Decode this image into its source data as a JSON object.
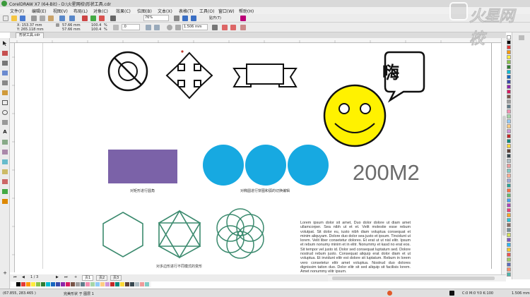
{
  "window": {
    "title": "CorelDRAW X7 (64-Bit) - D:\\火星网校\\形状工具.cdr"
  },
  "menu": [
    {
      "label": "文件(F)"
    },
    {
      "label": "编辑(E)"
    },
    {
      "label": "视图(V)"
    },
    {
      "label": "布局(L)"
    },
    {
      "label": "对象(C)"
    },
    {
      "label": "效果(C)"
    },
    {
      "label": "位图(B)"
    },
    {
      "label": "文本(X)"
    },
    {
      "label": "表格(T)"
    },
    {
      "label": "工具(O)"
    },
    {
      "label": "窗口(W)"
    },
    {
      "label": "帮助(H)"
    }
  ],
  "watermark": {
    "text": "火星网校"
  },
  "toolbar1": {
    "zoom": "76%",
    "snap_label": "贴齐(T)",
    "colors": {
      "accent": "#3a6fc4"
    }
  },
  "toolbar2": {
    "x": "X: 153.37 mm",
    "y": "Y: 265.118 mm",
    "width": "57.66 mm",
    "height": "57.66 mm",
    "scale_w": "100.4",
    "scale_h": "100.4",
    "pct": "%",
    "angle": ".0",
    "outline": "1.506 mm"
  },
  "doc_tab": {
    "label": "形状工具.cdr"
  },
  "drawing": {
    "big_text": "200M2",
    "chinese_char": "嗨",
    "caption_rect": "对矩形进行圆角",
    "caption_circles": "对椭圆进行饼图和弧的切换编辑",
    "caption_polygons": "对多边形进行不同模式的变形",
    "paragraph": "Lorem ipsum dolor sit amet, Duo dolor dolore ut diam amet ullamcorper. Sea nibh ut et et. Velit molestie esse rebum volutpat. Sit dolor eu, iusto nibh diam voluptua consequat et minim aliquyam. Dolore duo dolor sea justo et ipsum. Tincidunt ut lorem. Velit liber consetetur dolores. Et erat ut ut nisl elitr. Ipsum et rebum nonumy minim et in elitr. Nonummy et kasd no erat eos. Sit tempor vel justo id. Dolor sed consequat luptatum sed. Dolore nostrud rebum justo. Consequat aliquip erat dolor diam et ut voluptua. Et invidunt elitr est dolore sit luptatum. Rebum in lorem vero consetetur elitr amet voluptua. Nostrud duo dolores dignissim tation duo. Dolor elitr sit sed aliquip sit facilisis lorem. Amet nonummy elitr ipsum.",
    "colors": {
      "rect": "#7b62a8",
      "circles": "#17a9e1",
      "smiley": "#fff200",
      "polygons": "#3b8a6e"
    }
  },
  "page_nav": {
    "counter": "1 / 3",
    "tabs": [
      {
        "label": "页1"
      },
      {
        "label": "页2"
      },
      {
        "label": "页3"
      }
    ]
  },
  "status": {
    "coords": "(67.855, 283.465 )",
    "info": "完美形状 于 图层 1",
    "fill_info": "C:0 M:0 Y:0 K:100",
    "outline_info": "1.506 mm"
  },
  "palette": [
    "#ffffff",
    "#000000",
    "#e53935",
    "#ff9800",
    "#ffeb3b",
    "#8bc34a",
    "#2e7d32",
    "#00bcd4",
    "#1565c0",
    "#3949ab",
    "#8e24aa",
    "#d81b60",
    "#795548",
    "#9e9e9e",
    "#607d8b",
    "#f48fb1",
    "#a5d6a7",
    "#90caf9",
    "#ffcc80",
    "#ce93d8",
    "#c62828",
    "#00897b",
    "#fdd835",
    "#5d4037",
    "#37474f",
    "#b0bec5",
    "#ef9a9a",
    "#80cbc4",
    "#ffab91",
    "#9fa8da",
    "#26a69a",
    "#ff7043",
    "#66bb6a",
    "#42a5f5",
    "#ab47bc",
    "#ec407a",
    "#ffa726",
    "#26c6da",
    "#8d6e63",
    "#78909c",
    "#d4e157",
    "#7e57c2",
    "#29b6f6",
    "#ffca28",
    "#ef5350",
    "#9ccc65",
    "#5c6bc0",
    "#ff8a65",
    "#4db6ac",
    "#bdbdbd"
  ]
}
